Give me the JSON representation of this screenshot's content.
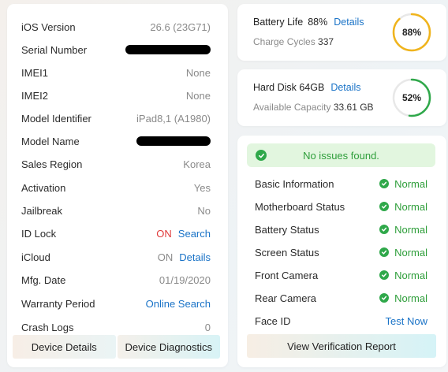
{
  "device_info": {
    "rows": [
      {
        "label": "iOS Version",
        "value": "26.6 (23G71)"
      },
      {
        "label": "Serial Number",
        "value": ""
      },
      {
        "label": "IMEI1",
        "value": "None"
      },
      {
        "label": "IMEI2",
        "value": "None"
      },
      {
        "label": "Model Identifier",
        "value": "iPad8,1 (A1980)"
      },
      {
        "label": "Model Name",
        "value": ""
      },
      {
        "label": "Sales Region",
        "value": "Korea"
      },
      {
        "label": "Activation",
        "value": "Yes"
      },
      {
        "label": "Jailbreak",
        "value": "No"
      },
      {
        "label": "ID Lock",
        "value": "ON",
        "link": "Search"
      },
      {
        "label": "iCloud",
        "value": "ON",
        "link": "Details"
      },
      {
        "label": "Mfg. Date",
        "value": "01/19/2020"
      },
      {
        "label": "Warranty Period",
        "link": "Online Search"
      },
      {
        "label": "Crash Logs",
        "value": "0"
      }
    ],
    "buttons": {
      "device_details": "Device Details",
      "device_diagnostics": "Device Diagnostics"
    }
  },
  "battery": {
    "label": "Battery Life",
    "value": "88%",
    "link": "Details",
    "cycles_label": "Charge Cycles",
    "cycles_value": "337",
    "gauge_text": "88%",
    "gauge_fraction": 0.88,
    "gauge_color": "#f0b41c"
  },
  "disk": {
    "label": "Hard Disk 64GB",
    "link": "Details",
    "available_label": "Available Capacity",
    "available_value": "33.61 GB",
    "gauge_text": "52%",
    "gauge_fraction": 0.52,
    "gauge_color": "#2fa84a"
  },
  "diagnostics": {
    "banner": "No issues found.",
    "rows": [
      {
        "label": "Basic Information",
        "status": "Normal"
      },
      {
        "label": "Motherboard Status",
        "status": "Normal"
      },
      {
        "label": "Battery Status",
        "status": "Normal"
      },
      {
        "label": "Screen Status",
        "status": "Normal"
      },
      {
        "label": "Front Camera",
        "status": "Normal"
      },
      {
        "label": "Rear Camera",
        "status": "Normal"
      },
      {
        "label": "Face ID",
        "link": "Test Now"
      }
    ],
    "verify_button": "View Verification Report"
  },
  "colors": {
    "accent_link": "#1a73c7",
    "ok_green": "#2fa84a",
    "warn_red": "#e03a3a"
  }
}
